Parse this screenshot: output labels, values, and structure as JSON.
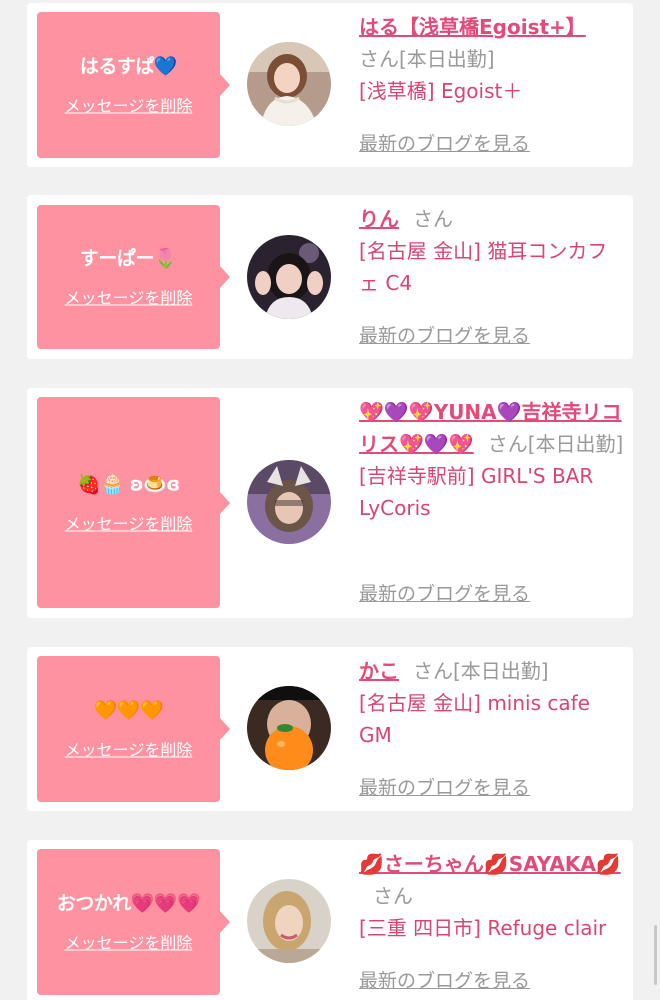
{
  "delete_label": "メッセージを削除",
  "blog_label": "最新のブログを見る",
  "honorific": "さん",
  "cards": [
    {
      "bubble_text": "はるすぱ💙",
      "name": "はる【浅草橋Egoist+】",
      "status": "[本日出勤]",
      "shop": "[浅草橋] Egoist＋",
      "avatar_icon": "woman-white-dress-avatar"
    },
    {
      "bubble_text": "すーぱー🌷",
      "name": "りん",
      "status": "",
      "shop": "[名古屋 金山] 猫耳コンカフェ C4",
      "avatar_icon": "girl-peace-sign-avatar"
    },
    {
      "bubble_text": "🍓🧁 ʚ🍮ɞ",
      "name": "💖💜💖YUNA💜吉祥寺リコリス💖💜💖",
      "status": "[本日出勤]",
      "shop": "[吉祥寺駅前] GIRL'S BAR LyCoris",
      "avatar_icon": "girl-cat-ears-avatar"
    },
    {
      "bubble_text": "🧡🧡🧡",
      "name": "かこ",
      "status": "[本日出勤]",
      "shop": "[名古屋 金山] minis cafe GM",
      "avatar_icon": "orange-face-avatar"
    },
    {
      "bubble_text": "おつかれ💗💗💗",
      "name": "💋さーちゃん💋SAYAKA💋",
      "status": "",
      "shop": "[三重 四日市] Refuge clair",
      "avatar_icon": "blonde-woman-avatar"
    }
  ],
  "colors": {
    "background": "#f1f1f1",
    "card": "#ffffff",
    "bubble": "#ff92a0",
    "name": "#e24a78",
    "shop": "#d94570",
    "muted": "#9a9a9a"
  }
}
